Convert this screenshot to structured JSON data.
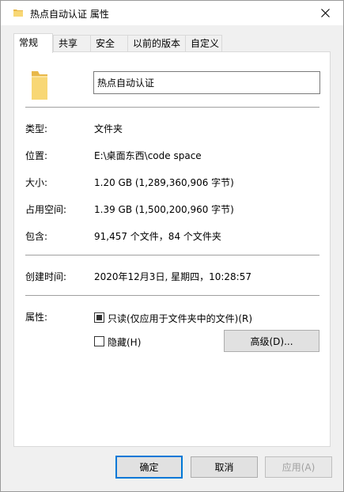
{
  "window": {
    "title": "热点自动认证 属性"
  },
  "tabs": [
    {
      "label": "常规"
    },
    {
      "label": "共享"
    },
    {
      "label": "安全"
    },
    {
      "label": "以前的版本"
    },
    {
      "label": "自定义"
    }
  ],
  "general": {
    "name_value": "热点自动认证",
    "type_label": "类型:",
    "type_value": "文件夹",
    "location_label": "位置:",
    "location_value": "E:\\桌面东西\\code space",
    "size_label": "大小:",
    "size_value": "1.20 GB (1,289,360,906 字节)",
    "disk_label": "占用空间:",
    "disk_value": "1.39 GB (1,500,200,960 字节)",
    "contains_label": "包含:",
    "contains_value": "91,457 个文件，84 个文件夹",
    "created_label": "创建时间:",
    "created_value": "2020年12月3日, 星期四，10:28:57",
    "attributes_label": "属性:",
    "readonly_label": "只读(仅应用于文件夹中的文件)(R)",
    "readonly_state": "indeterminate",
    "hidden_label": "隐藏(H)",
    "hidden_state": "unchecked",
    "advanced_label": "高级(D)..."
  },
  "buttons": {
    "ok": "确定",
    "cancel": "取消",
    "apply": "应用(A)"
  },
  "colors": {
    "accent": "#0078d7",
    "folder": "#f8d775"
  }
}
